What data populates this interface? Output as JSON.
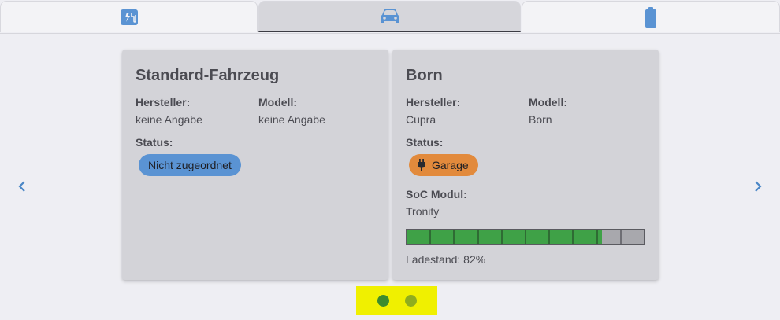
{
  "tabs": [
    {
      "icon": "charge-point-icon",
      "label": ""
    },
    {
      "icon": "car-icon",
      "label": "",
      "active": true
    },
    {
      "icon": "battery-icon",
      "label": ""
    }
  ],
  "colors": {
    "accent": "#5a93d3",
    "chip_blue": "#5a93d3",
    "chip_orange": "#e28a3c",
    "progress_green": "#3fa147",
    "highlight": "#f0f000"
  },
  "vehicles": [
    {
      "title": "Standard-Fahrzeug",
      "manufacturer_label": "Hersteller:",
      "manufacturer": "keine Angabe",
      "model_label": "Modell:",
      "model": "keine Angabe",
      "status_label": "Status:",
      "status": "Nicht zugeordnet"
    },
    {
      "title": "Born",
      "manufacturer_label": "Hersteller:",
      "manufacturer": "Cupra",
      "model_label": "Modell:",
      "model": "Born",
      "status_label": "Status:",
      "status": "Garage",
      "status_icon": "plug-icon",
      "soc_module_label": "SoC Modul:",
      "soc_module": "Tronity",
      "soc_percent": 82,
      "soc_text": "Ladestand: 82%"
    }
  ],
  "navigation": {
    "prev_icon": "chevron-left-icon",
    "next_icon": "chevron-right-icon"
  },
  "pagination": {
    "pages": 2,
    "current": 1
  }
}
